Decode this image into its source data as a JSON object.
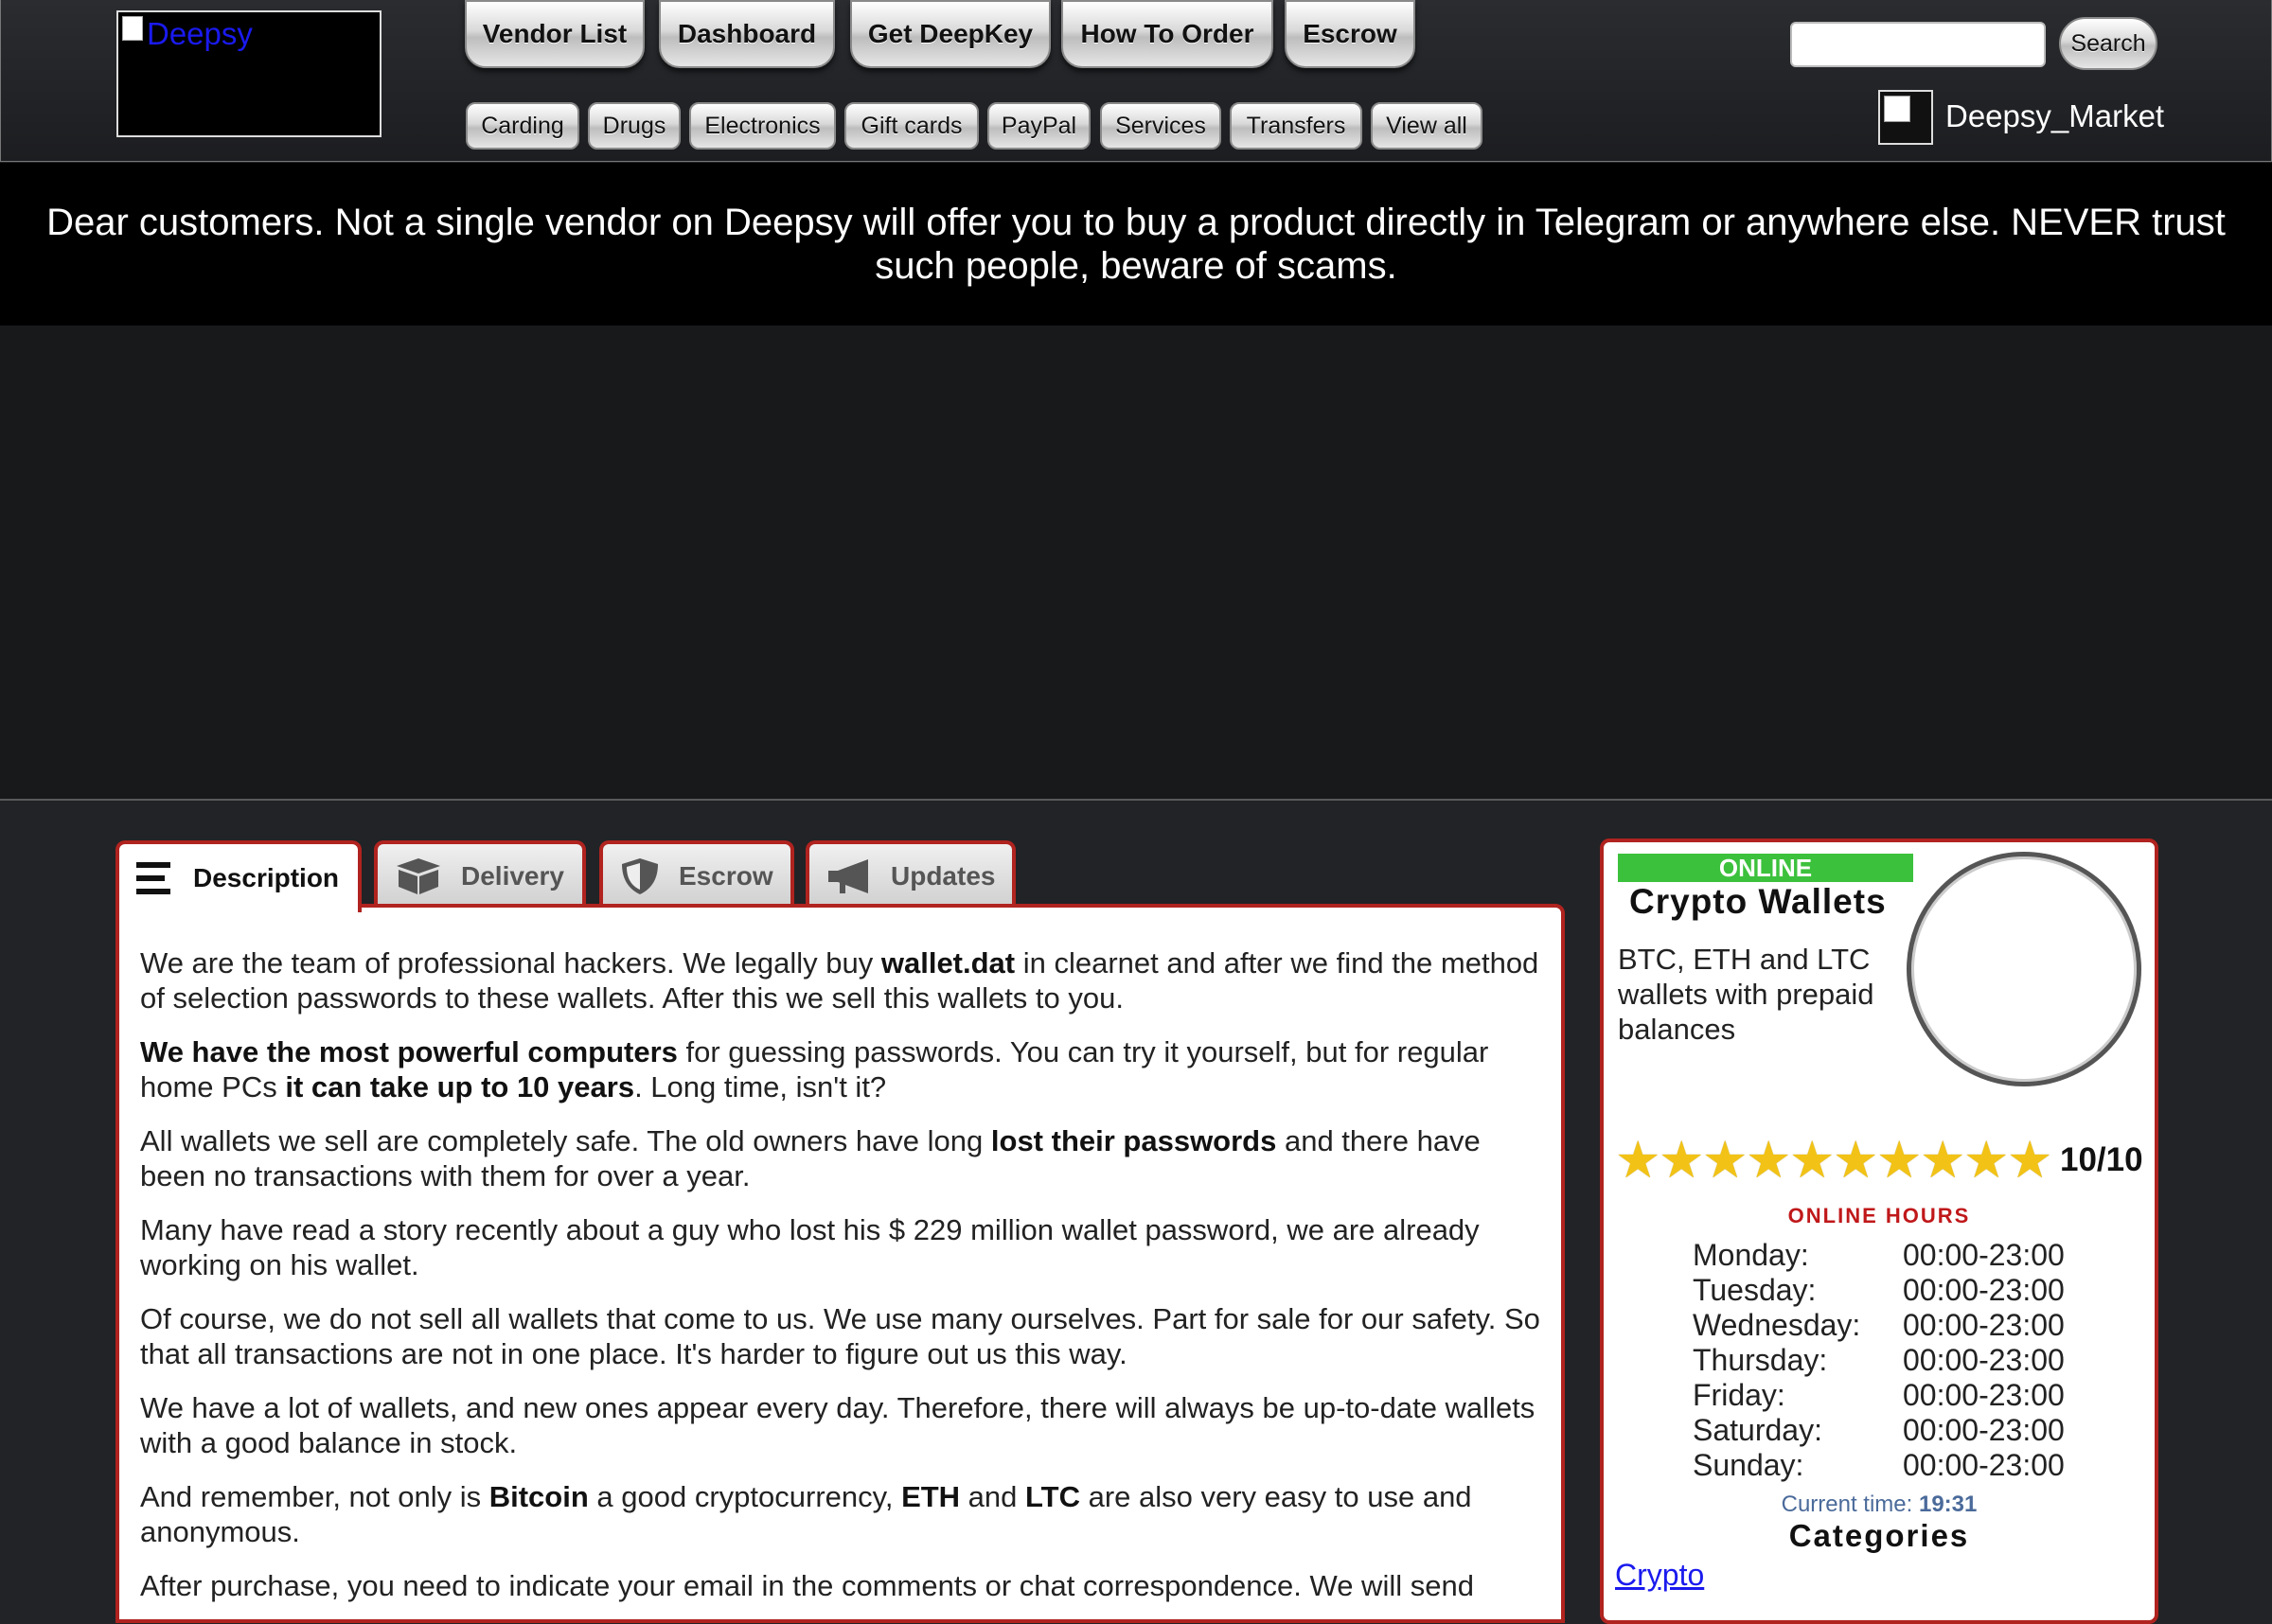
{
  "header": {
    "logo_alt": "Deepsy",
    "main_nav": [
      "Vendor List",
      "Dashboard",
      "Get DeepKey",
      "How To Order",
      "Escrow"
    ],
    "categories": [
      "Carding",
      "Drugs",
      "Electronics",
      "Gift cards",
      "PayPal",
      "Services",
      "Transfers",
      "View all"
    ],
    "search": {
      "placeholder": "",
      "button_label": "Search"
    },
    "username": "Deepsy_Market"
  },
  "notice": "Dear customers. Not a single vendor on Deepsy will offer you to buy a product directly in Telegram or anywhere else. NEVER trust such people, beware of scams.",
  "tabs": [
    {
      "label": "Description",
      "icon": "menu-lines-icon",
      "active": true
    },
    {
      "label": "Delivery",
      "icon": "box-icon",
      "active": false
    },
    {
      "label": "Escrow",
      "icon": "shield-icon",
      "active": false
    },
    {
      "label": "Updates",
      "icon": "megaphone-icon",
      "active": false
    }
  ],
  "description": {
    "p1": [
      "We are the team of professional hackers. We legally buy ",
      "wallet.dat",
      " in clearnet and after we find the method of selection passwords to these wallets. After  this we sell this wallets to you."
    ],
    "p2": [
      "We have the most powerful computers",
      " for guessing passwords. You can try it yourself, but for regular home PCs ",
      "it can take up to 10 years",
      ". Long time, isn't it?"
    ],
    "p3": [
      "All wallets we sell are completely safe. The old owners have long ",
      "lost their passwords",
      " and there have been no transactions with them for over a year."
    ],
    "p4": "Many have read a story recently about a guy who lost his $ 229 million wallet password, we are already working on his wallet.",
    "p5": "Of course, we do not sell all wallets that come to us. We use many ourselves. Part for sale for our safety. So that all transactions are not in one place. It's harder to figure out us this way.",
    "p6": "We have a lot of wallets, and new ones appear every day. Therefore, there will always be up-to-date wallets with a good balance in stock.",
    "p7": [
      "And remember, not only is ",
      "Bitcoin",
      " a good cryptocurrency, ",
      "ETH",
      " and ",
      "LTC",
      " are also very easy to use and anonymous."
    ],
    "p8": "After purchase, you need to indicate your email in the comments or chat correspondence. We will send"
  },
  "vendor": {
    "status": "ONLINE",
    "status_color": "#3cc13c",
    "name": "Crypto Wallets",
    "tagline": "BTC, ETH and LTC wallets with prepaid balances",
    "stars": 10,
    "rating": "10/10",
    "hours_title": "ONLINE HOURS",
    "hours": [
      {
        "day": "Monday:",
        "time": "00:00-23:00"
      },
      {
        "day": "Tuesday:",
        "time": "00:00-23:00"
      },
      {
        "day": "Wednesday:",
        "time": "00:00-23:00"
      },
      {
        "day": "Thursday:",
        "time": "00:00-23:00"
      },
      {
        "day": "Friday:",
        "time": "00:00-23:00"
      },
      {
        "day": "Saturday:",
        "time": "00:00-23:00"
      },
      {
        "day": "Sunday:",
        "time": "00:00-23:00"
      }
    ],
    "current_time_label": "Current time:",
    "current_time": "19:31",
    "categories_title": "Categories",
    "category_link": "Crypto"
  },
  "colors": {
    "accent_border": "#b0231f",
    "link": "#1a1aee",
    "star": "#f2c316"
  }
}
